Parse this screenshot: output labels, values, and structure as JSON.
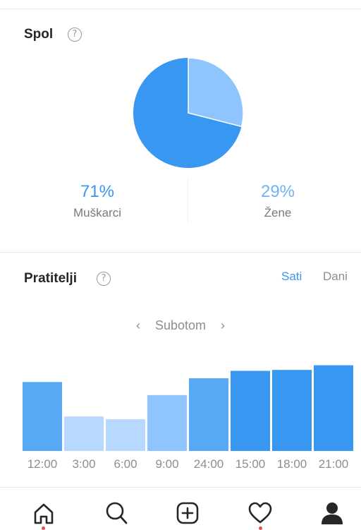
{
  "gender": {
    "title": "Spol",
    "help_glyph": "?",
    "male": {
      "percent": "71%",
      "label": "Muškarci",
      "fraction": 0.71,
      "color": "#3897f0"
    },
    "female": {
      "percent": "29%",
      "label": "Žene",
      "fraction": 0.29,
      "color": "#8ec5ff"
    }
  },
  "followers": {
    "title": "Pratitelji",
    "help_glyph": "?",
    "toggle": {
      "hours": "Sati",
      "days": "Dani",
      "active": "hours"
    },
    "day": {
      "prev": "‹",
      "label": "Subotom",
      "next": "›"
    }
  },
  "chart_data": {
    "type": "bar",
    "categories": [
      "12:00",
      "3:00",
      "6:00",
      "9:00",
      "24:00",
      "15:00",
      "18:00",
      "21:00"
    ],
    "values": [
      74,
      37,
      34,
      60,
      78,
      86,
      87,
      92
    ],
    "ylim": [
      0,
      100
    ],
    "bar_colors": [
      "#58a9f5",
      "#b7d9ff",
      "#b7d9ff",
      "#8ec5ff",
      "#58a9f5",
      "#3897f0",
      "#3897f0",
      "#3897f0"
    ]
  },
  "tabbar": {
    "items": [
      {
        "icon": "home-icon",
        "dot": true
      },
      {
        "icon": "search-icon",
        "dot": false
      },
      {
        "icon": "add-post-icon",
        "dot": false
      },
      {
        "icon": "heart-icon",
        "dot": true
      },
      {
        "icon": "profile-icon",
        "dot": false
      }
    ],
    "dot_color": "#ed4956"
  },
  "colors": {
    "accent": "#3897f0",
    "muted": "#8e8e8e",
    "text": "#262626"
  }
}
